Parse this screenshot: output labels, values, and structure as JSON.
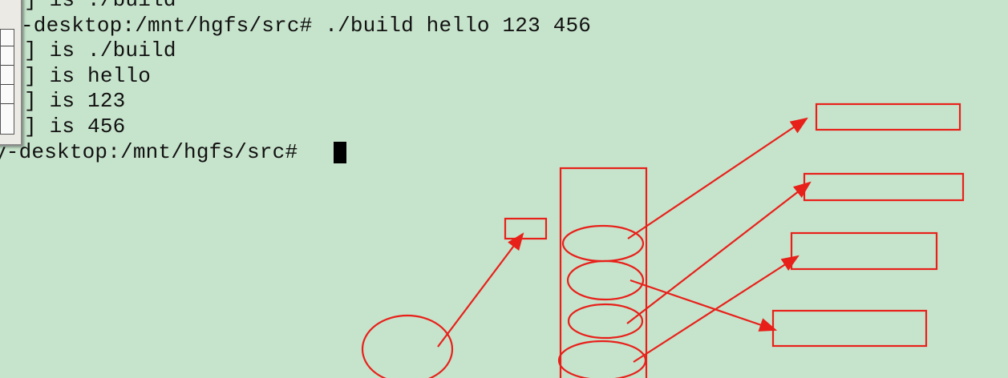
{
  "terminal": {
    "lines": [
      "] is ./build",
      "-desktop:/mnt/hgfs/src# ./build hello 123 456",
      "] is ./build",
      "] is hello",
      "] is 123",
      "] is 456",
      "y-desktop:/mnt/hgfs/src# "
    ]
  },
  "colors": {
    "background": "#c6e3cb",
    "text": "#111111",
    "annotation": "#e8201a",
    "cursor": "#000000"
  }
}
